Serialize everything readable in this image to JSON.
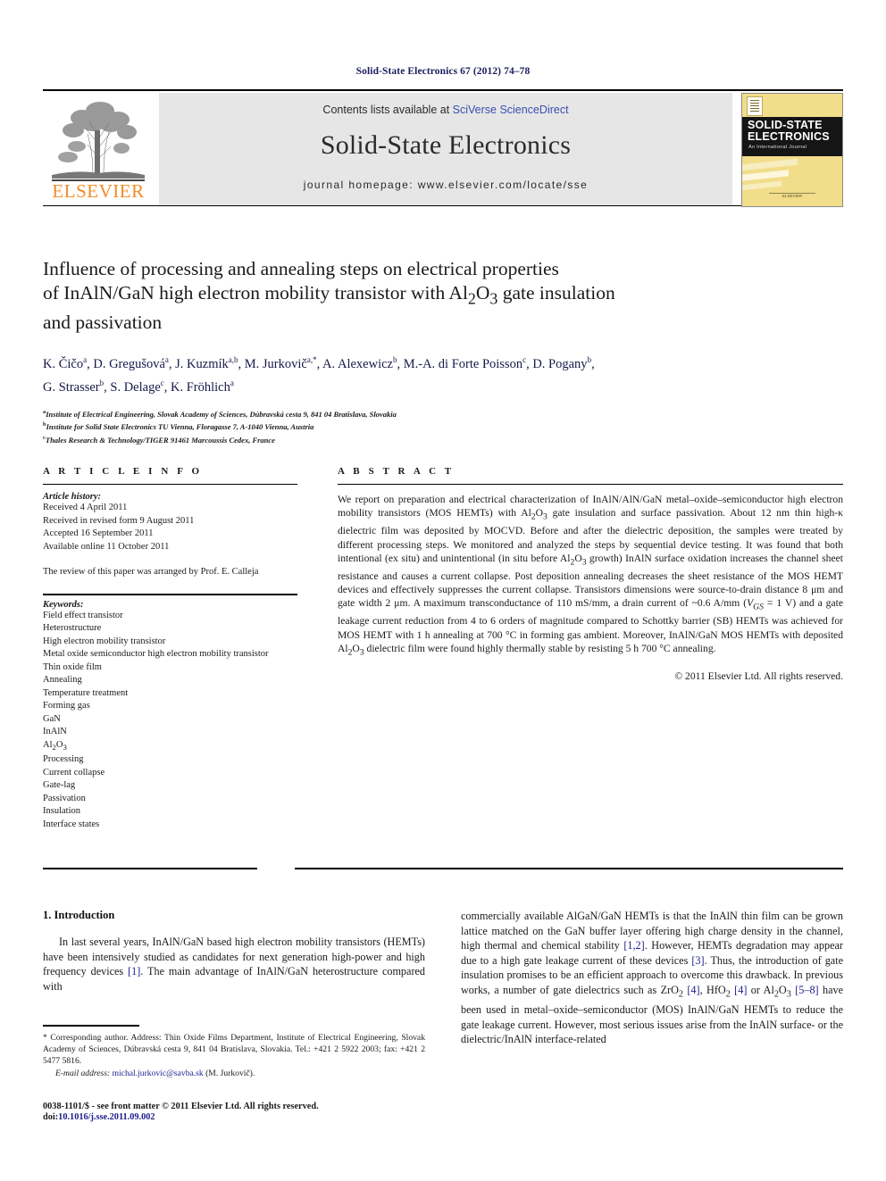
{
  "running_head": "Solid-State Electronics 67 (2012) 74–78",
  "masthead": {
    "contents_prefix": "Contents lists available at ",
    "contents_link": "SciVerse ScienceDirect",
    "journal_name": "Solid-State Electronics",
    "homepage": "journal homepage: www.elsevier.com/locate/sse",
    "publisher_wordmark": "ELSEVIER",
    "cover": {
      "title_line1": "SOLID-STATE",
      "title_line2": "ELECTRONICS",
      "subtitle": "An International Journal",
      "footer": "ELSEVIER"
    }
  },
  "title": {
    "line1": "Influence of processing and annealing steps on electrical properties",
    "line2_a": "of InAlN/GaN high electron mobility transistor with Al",
    "line2_sub1": "2",
    "line2_b": "O",
    "line2_sub2": "3",
    "line2_c": " gate insulation",
    "line3": "and passivation"
  },
  "authors": {
    "line1": "K. Čičo a, D. Gregušová a, J. Kuzmík a,b, M. Jurkovič a,*, A. Alexewicz b, M.-A. di Forte Poisson c, D. Pogany b,",
    "line2": "G. Strasser b, S. Delage c, K. Fröhlich a"
  },
  "affiliations": [
    {
      "mark": "a",
      "text": "Institute of Electrical Engineering, Slovak Academy of Sciences, Dúbravská cesta 9, 841 04 Bratislava, Slovakia"
    },
    {
      "mark": "b",
      "text": "Institute for Solid State Electronics TU Vienna, Floragasse 7, A-1040 Vienna, Austria"
    },
    {
      "mark": "c",
      "text": "Thales Research & Technology/TIGER 91461 Marcoussis Cedex, France"
    }
  ],
  "article_info": {
    "heading": "A R T I C L E   I N F O",
    "history_label": "Article history:",
    "history": [
      "Received 4 April 2011",
      "Received in revised form 9 August 2011",
      "Accepted 16 September 2011",
      "Available online 11 October 2011"
    ],
    "review_note": "The review of this paper was arranged by Prof. E. Calleja",
    "keywords_label": "Keywords:",
    "keywords": [
      "Field effect transistor",
      "Heterostructure",
      "High electron mobility transistor",
      "Metal oxide semiconductor high electron mobility transistor",
      "Thin oxide film",
      "Annealing",
      "Temperature treatment",
      "Forming gas",
      "GaN",
      "InAlN",
      "Al2O3",
      "Processing",
      "Current collapse",
      "Gate-lag",
      "Passivation",
      "Insulation",
      "Interface states"
    ]
  },
  "abstract": {
    "heading": "A B S T R A C T",
    "text": "We report on preparation and electrical characterization of InAlN/AlN/GaN metal–oxide–semiconductor high electron mobility transistors (MOS HEMTs) with Al2O3 gate insulation and surface passivation. About 12 nm thin high-κ dielectric film was deposited by MOCVD. Before and after the dielectric deposition, the samples were treated by different processing steps. We monitored and analyzed the steps by sequential device testing. It was found that both intentional (ex situ) and unintentional (in situ before Al2O3 growth) InAlN surface oxidation increases the channel sheet resistance and causes a current collapse. Post deposition annealing decreases the sheet resistance of the MOS HEMT devices and effectively suppresses the current collapse. Transistors dimensions were source-to-drain distance 8 μm and gate width 2 μm. A maximum transconductance of 110 mS/mm, a drain current of ~0.6 A/mm (VGS = 1 V) and a gate leakage current reduction from 4 to 6 orders of magnitude compared to Schottky barrier (SB) HEMTs was achieved for MOS HEMT with 1 h annealing at 700 °C in forming gas ambient. Moreover, InAlN/GaN MOS HEMTs with deposited Al2O3 dielectric film were found highly thermally stable by resisting 5 h 700 °C annealing.",
    "copyright": "© 2011 Elsevier Ltd. All rights reserved."
  },
  "body": {
    "section_title": "1. Introduction",
    "left_paragraph": "In last several years, InAlN/GaN based high electron mobility transistors (HEMTs) have been intensively studied as candidates for next generation high-power and high frequency devices [1]. The main advantage of InAlN/GaN heterostructure compared with",
    "right_paragraph": "commercially available AlGaN/GaN HEMTs is that the InAlN thin film can be grown lattice matched on the GaN buffer layer offering high charge density in the channel, high thermal and chemical stability [1,2]. However, HEMTs degradation may appear due to a high gate leakage current of these devices [3]. Thus, the introduction of gate insulation promises to be an efficient approach to overcome this drawback. In previous works, a number of gate dielectrics such as ZrO2 [4], HfO2 [4] or Al2O3 [5–8] have been used in metal–oxide–semiconductor (MOS) InAlN/GaN HEMTs to reduce the gate leakage current. However, most serious issues arise from the InAlN surface- or the dielectric/InAlN interface-related"
  },
  "footnote": {
    "text": "* Corresponding author. Address: Thin Oxide Films Department, Institute of Electrical Engineering, Slovak Academy of Sciences, Dúbravská cesta 9, 841 04 Bratislava, Slovakia. Tel.: +421 2 5922 2003; fax: +421 2 5477 5816.",
    "email_label": "E-mail address:",
    "email": "michal.jurkovic@savba.sk",
    "email_owner": "(M. Jurkovič)."
  },
  "footer": {
    "issn_line": "0038-1101/$ - see front matter © 2011 Elsevier Ltd. All rights reserved.",
    "doi_label": "doi:",
    "doi": "10.1016/j.sse.2011.09.002"
  },
  "colors": {
    "link": "#1c1c8c",
    "accent_orange": "#f28c28",
    "author_navy": "#17184a",
    "cover_yellow": "#f1dd8a"
  }
}
